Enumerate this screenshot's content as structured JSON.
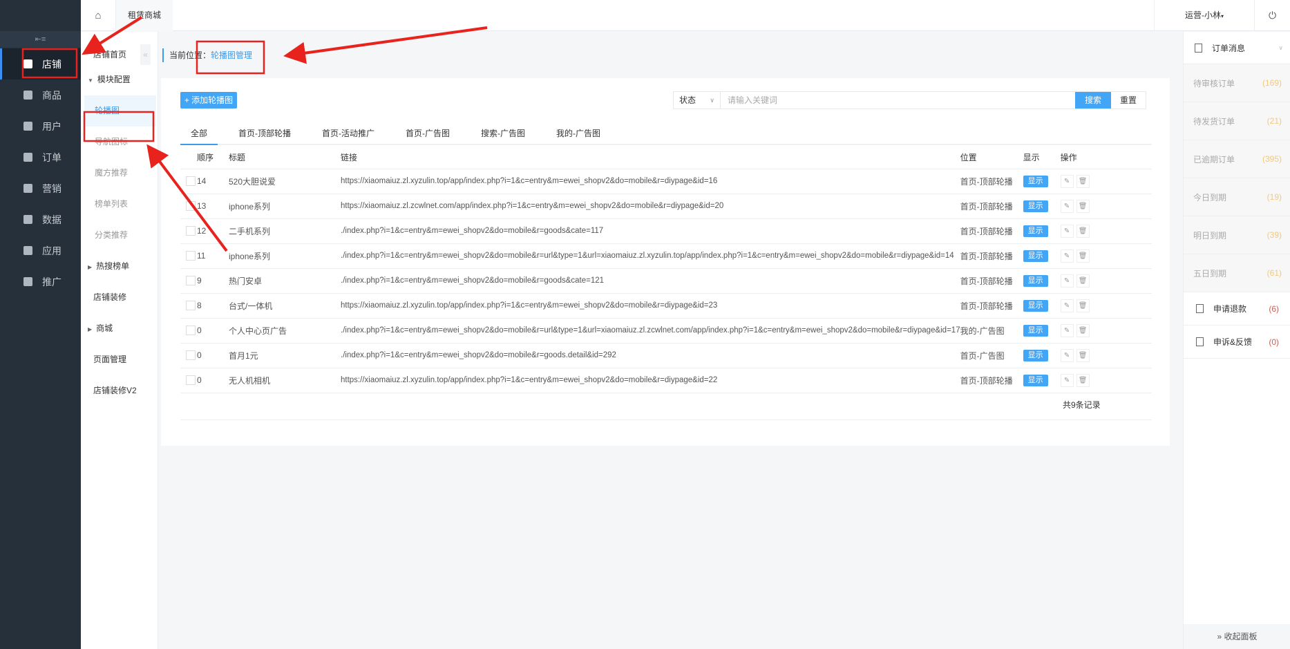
{
  "topbar": {
    "tab": "租赁商城",
    "user": "运营-小林",
    "user_caret": "▾"
  },
  "sidebar": {
    "collapse_icon": "⇤≡",
    "items": [
      {
        "label": "店铺",
        "icon": "store-icon"
      },
      {
        "label": "商品",
        "icon": "goods-icon"
      },
      {
        "label": "用户",
        "icon": "user-icon"
      },
      {
        "label": "订单",
        "icon": "order-icon"
      },
      {
        "label": "营销",
        "icon": "gift-icon"
      },
      {
        "label": "数据",
        "icon": "chart-icon"
      },
      {
        "label": "应用",
        "icon": "apps-icon"
      },
      {
        "label": "推广",
        "icon": "promote-icon"
      }
    ]
  },
  "subnav": {
    "collapse": "«",
    "items": [
      "店铺首页",
      "模块配置",
      "轮播图",
      "导航图标",
      "魔方推荐",
      "榜单列表",
      "分类推荐",
      "热搜榜单",
      "店铺装修",
      "商城",
      "页面管理",
      "店铺装修V2"
    ]
  },
  "breadcrumb": {
    "prefix": "当前位置：",
    "current": "轮播图管理"
  },
  "toolbar": {
    "add": "+ 添加轮播图",
    "status": "状态",
    "placeholder": "请输入关键词",
    "search": "搜索",
    "reset": "重置"
  },
  "tabs": [
    "全部",
    "首页-顶部轮播",
    "首页-活动推广",
    "首页-广告图",
    "搜索-广告图",
    "我的-广告图"
  ],
  "table": {
    "headers": [
      "顺序",
      "标题",
      "链接",
      "位置",
      "显示",
      "操作"
    ],
    "rows": [
      {
        "order": "14",
        "title": "520大胆说爱",
        "link": "https://xiaomaiuz.zl.xyzulin.top/app/index.php?i=1&c=entry&m=ewei_shopv2&do=mobile&r=diypage&id=16",
        "position": "首页-顶部轮播",
        "show": "显示"
      },
      {
        "order": "13",
        "title": "iphone系列",
        "link": "https://xiaomaiuz.zl.zcwlnet.com/app/index.php?i=1&c=entry&m=ewei_shopv2&do=mobile&r=diypage&id=20",
        "position": "首页-顶部轮播",
        "show": "显示"
      },
      {
        "order": "12",
        "title": "二手机系列",
        "link": "./index.php?i=1&c=entry&m=ewei_shopv2&do=mobile&r=goods&cate=117",
        "position": "首页-顶部轮播",
        "show": "显示"
      },
      {
        "order": "11",
        "title": "iphone系列",
        "link": "./index.php?i=1&c=entry&m=ewei_shopv2&do=mobile&r=url&type=1&url=xiaomaiuz.zl.xyzulin.top/app/index.php?i=1&c=entry&m=ewei_shopv2&do=mobile&r=diypage&id=14",
        "position": "首页-顶部轮播",
        "show": "显示"
      },
      {
        "order": "9",
        "title": "热门安卓",
        "link": "./index.php?i=1&c=entry&m=ewei_shopv2&do=mobile&r=goods&cate=121",
        "position": "首页-顶部轮播",
        "show": "显示"
      },
      {
        "order": "8",
        "title": "台式/一体机",
        "link": "https://xiaomaiuz.zl.xyzulin.top/app/index.php?i=1&c=entry&m=ewei_shopv2&do=mobile&r=diypage&id=23",
        "position": "首页-顶部轮播",
        "show": "显示"
      },
      {
        "order": "0",
        "title": "个人中心页广告",
        "link": "./index.php?i=1&c=entry&m=ewei_shopv2&do=mobile&r=url&type=1&url=xiaomaiuz.zl.zcwlnet.com/app/index.php?i=1&c=entry&m=ewei_shopv2&do=mobile&r=diypage&id=17",
        "position": "我的-广告图",
        "show": "显示"
      },
      {
        "order": "0",
        "title": "首月1元",
        "link": "./index.php?i=1&c=entry&m=ewei_shopv2&do=mobile&r=goods.detail&id=292",
        "position": "首页-广告图",
        "show": "显示"
      },
      {
        "order": "0",
        "title": "无人机相机",
        "link": "https://xiaomaiuz.zl.xyzulin.top/app/index.php?i=1&c=entry&m=ewei_shopv2&do=mobile&r=diypage&id=22",
        "position": "首页-顶部轮播",
        "show": "显示"
      }
    ],
    "total": "共9条记录"
  },
  "right_panel": {
    "title": "订单消息",
    "items": [
      {
        "label": "待审核订单",
        "count": "(169)"
      },
      {
        "label": "待发货订单",
        "count": "(21)"
      },
      {
        "label": "已逾期订单",
        "count": "(395)"
      },
      {
        "label": "今日到期",
        "count": "(19)"
      },
      {
        "label": "明日到期",
        "count": "(39)"
      },
      {
        "label": "五日到期",
        "count": "(61)"
      }
    ],
    "links": [
      {
        "label": "申请退款",
        "count": "(6)"
      },
      {
        "label": "申诉&反馈",
        "count": "(0)"
      }
    ],
    "collapse": "» 收起面板"
  },
  "colors": {
    "accent": "#42a5f5",
    "sidebar": "#25303b",
    "annotation": "#e8231d"
  }
}
